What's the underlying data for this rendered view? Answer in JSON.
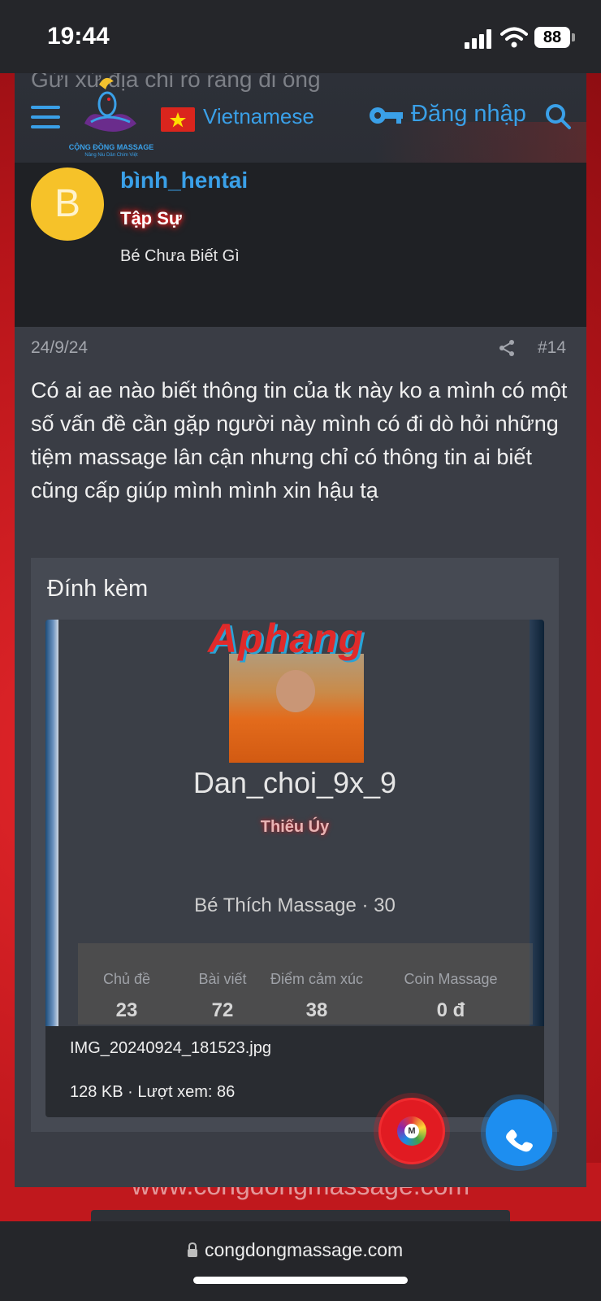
{
  "status_bar": {
    "time": "19:44",
    "battery": "88"
  },
  "header": {
    "ghost_text": "Gửi xử địa chỉ rõ ràng đi ông",
    "logo_text": "CỘNG ĐỒNG MASSAGE",
    "logo_sub": "Nâng Niu Dân Chim Việt",
    "language": "Vietnamese",
    "login_label": "Đăng nhập"
  },
  "post": {
    "avatar_letter": "B",
    "username": "bình_hentai",
    "rank": "Tập Sự",
    "user_title": "Bé Chưa Biết Gì",
    "date": "24/9/24",
    "number": "#14",
    "body": "Có ai ae nào biết thông tin của tk này ko a mình có một số vấn đề cần gặp người này mình có đi dò hỏi những tiệm massage lân cận nhưng chỉ có thông tin ai biết cũng cấp giúp mình mình xin hậu tạ"
  },
  "attachment": {
    "heading": "Đính kèm",
    "watermark": "Aphang",
    "image_profile_name": "Dan_choi_9x_9",
    "image_rank": "Thiếu Úy",
    "image_title": "Bé Thích Massage · 30",
    "stats": [
      {
        "label": "Chủ đề",
        "value": "23"
      },
      {
        "label": "Bài viết",
        "value": "72"
      },
      {
        "label": "Điểm cảm xúc",
        "value": "38"
      },
      {
        "label": "Coin Massage",
        "value": "0 đ"
      }
    ],
    "file_name": "IMG_20240924_181523.jpg",
    "file_meta": "128 KB · Lượt xem: 86"
  },
  "background": {
    "site_url": "www.congdongmassage.com"
  },
  "browser": {
    "url": "congdongmassage.com"
  },
  "colors": {
    "accent": "#3aa0e8",
    "card": "#3a3d45",
    "rank_glow": "#ff2020"
  }
}
